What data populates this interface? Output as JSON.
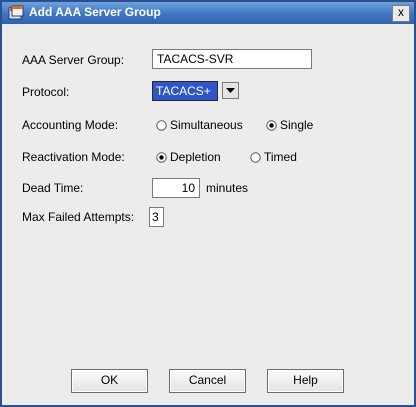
{
  "window": {
    "title": "Add AAA Server Group",
    "close_glyph": "x"
  },
  "form": {
    "server_group": {
      "label": "AAA Server Group:",
      "value": "TACACS-SVR"
    },
    "protocol": {
      "label": "Protocol:",
      "value": "TACACS+"
    },
    "accounting_mode": {
      "label": "Accounting Mode:",
      "options": [
        "Simultaneous",
        "Single"
      ],
      "selected": "Single"
    },
    "reactivation_mode": {
      "label": "Reactivation Mode:",
      "options": [
        "Depletion",
        "Timed"
      ],
      "selected": "Depletion"
    },
    "dead_time": {
      "label": "Dead Time:",
      "value": "10",
      "unit": "minutes"
    },
    "max_failed_attempts": {
      "label": "Max Failed Attempts:",
      "value": "3"
    }
  },
  "buttons": {
    "ok": "OK",
    "cancel": "Cancel",
    "help": "Help"
  },
  "icons": {
    "app": "asdm-window-icon",
    "dropdown": "chevron-down-icon",
    "close": "close-icon"
  },
  "colors": {
    "titlebar": "#3e75c2",
    "selection": "#2f55c9"
  }
}
